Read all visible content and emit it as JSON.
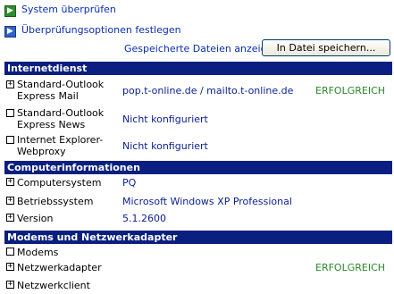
{
  "top_links": {
    "check_system": "System überprüfen",
    "check_options": "Überprüfungsoptionen festlegen",
    "saved_files": "Gespeicherte Dateien anzeigen",
    "save_to_file": "In Datei speichern..."
  },
  "sections": {
    "internet": "Internetdienst",
    "computer": "Computerinformationen",
    "modems": "Modems und Netzwerkadapter"
  },
  "internet_rows": [
    {
      "label_line1": "Standard-Outlook",
      "label_line2": "Express Mail",
      "value": "pop.t-online.de / mailto.t-online.de",
      "status": "ERFOLGREICH"
    },
    {
      "label_line1": "Standard-Outlook",
      "label_line2": "Express News",
      "value": "Nicht konfiguriert",
      "status": ""
    },
    {
      "label_line1": "Internet Explorer-",
      "label_line2": "Webproxy",
      "value": "Nicht konfiguriert",
      "status": ""
    }
  ],
  "computer_rows": [
    {
      "label": "Computersystem",
      "value": "PQ"
    },
    {
      "label": "Betriebssystem",
      "value": "Microsoft Windows XP Professional"
    },
    {
      "label": "Version",
      "value": "5.1.2600"
    }
  ],
  "modem_rows": [
    {
      "label": "Modems",
      "status": ""
    },
    {
      "label": "Netzwerkadapter",
      "status": "ERFOLGREICH"
    },
    {
      "label": "Netzwerkclient",
      "status": ""
    }
  ],
  "icons": {
    "check_system": "green-arrow-icon",
    "check_options": "blue-arrow-icon",
    "expand": "plus-box-icon",
    "empty": "empty-box-icon"
  },
  "colors": {
    "section_bg": "#0a1f7f",
    "link": "#0a2fb3",
    "success": "#2a8a2a"
  }
}
